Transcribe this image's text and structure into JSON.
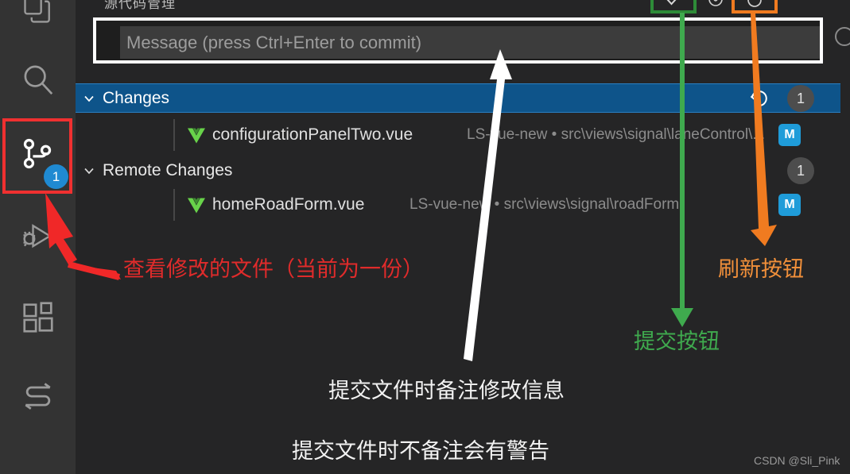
{
  "window": {
    "panel_title": "源代码管理",
    "watermark": "CSDN @Sli_Pink"
  },
  "colors": {
    "accent_blue": "#0e548a",
    "badge_blue": "#1f8ad2",
    "modified_badge": "#1f9cd9",
    "vue_green": "#4fc08d",
    "annotation_red": "#e02b2b",
    "annotation_green": "#3faa4e",
    "annotation_orange": "#f08f3a",
    "annotation_white": "#f2f2f2",
    "panel_bg": "#252526",
    "activity_bar_bg": "#333333"
  },
  "activity_bar": {
    "items": [
      {
        "name": "explorer",
        "icon": "files-icon",
        "badge": null
      },
      {
        "name": "search",
        "icon": "search-icon",
        "badge": null
      },
      {
        "name": "source-control",
        "icon": "source-control-icon",
        "badge": "1"
      },
      {
        "name": "run-and-debug",
        "icon": "run-debug-icon",
        "badge": null
      },
      {
        "name": "extensions",
        "icon": "extensions-icon",
        "badge": null
      },
      {
        "name": "settings-sync",
        "icon": "s-logo-icon",
        "badge": null
      }
    ]
  },
  "toolbar": {
    "collapse_label": "collapse-all-icon",
    "commit_label": "check-icon",
    "more_label": "more-actions-icon",
    "refresh_label": "refresh-icon"
  },
  "commit_input": {
    "placeholder": "Message (press Ctrl+Enter to commit)",
    "value": ""
  },
  "tree": {
    "sections": [
      {
        "label": "Changes",
        "count": "1",
        "expanded": true,
        "selected": true,
        "discard_icon": "discard-changes-icon",
        "files": [
          {
            "name": "configurationPanelTwo.vue",
            "path": "LS-vue-new • src\\views\\signal\\laneControl\\...",
            "status": "M",
            "icon": "vue-file-icon"
          }
        ]
      },
      {
        "label": "Remote Changes",
        "count": "1",
        "expanded": true,
        "selected": false,
        "files": [
          {
            "name": "homeRoadForm.vue",
            "path": "LS-vue-new • src\\views\\signal\\roadForm",
            "status": "M",
            "icon": "vue-file-icon"
          }
        ]
      }
    ]
  },
  "annotations": {
    "red": "查看修改的文件（当前为一份）",
    "green": "提交按钮",
    "orange": "刷新按钮",
    "white_line_1": "提交文件时备注修改信息",
    "white_line_2": "提交文件时不备注会有警告"
  }
}
